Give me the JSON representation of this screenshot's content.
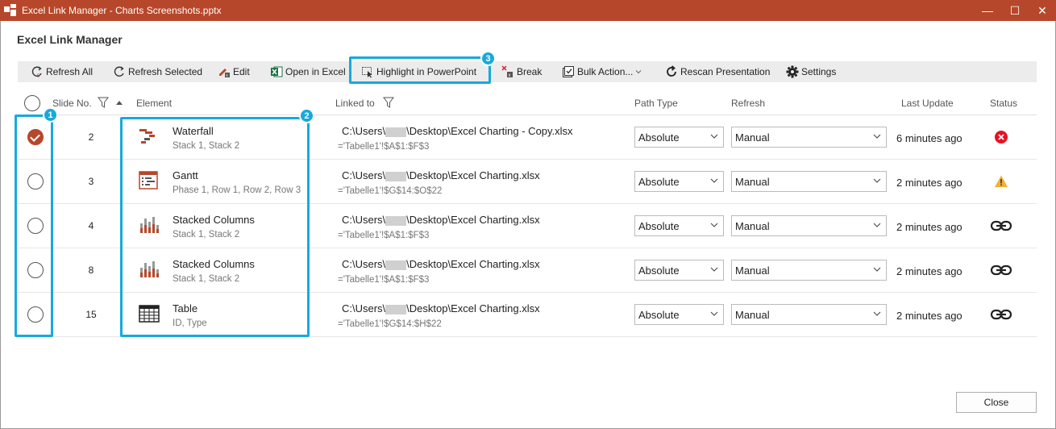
{
  "window": {
    "title": "Excel Link Manager - Charts Screenshots.pptx",
    "minimize": "—",
    "maximize": "☐",
    "close": "✕"
  },
  "heading": "Excel Link Manager",
  "toolbar": {
    "refresh_all": "Refresh All",
    "refresh_selected": "Refresh Selected",
    "edit": "Edit",
    "open_in_excel": "Open in Excel",
    "highlight": "Highlight in PowerPoint",
    "break": "Break",
    "bulk_actions": "Bulk Action...",
    "rescan": "Rescan Presentation",
    "settings": "Settings"
  },
  "badges": {
    "one": "1",
    "two": "2",
    "three": "3"
  },
  "columns": {
    "slide_no": "Slide No.",
    "element": "Element",
    "linked_to": "Linked to",
    "path_type": "Path Type",
    "refresh": "Refresh",
    "last_update": "Last Update",
    "status": "Status"
  },
  "rows": [
    {
      "checked": true,
      "slide": "2",
      "icon": "waterfall-icon",
      "name": "Waterfall",
      "sub": "Stack 1, Stack 2",
      "path_pre": "C:\\Users\\",
      "path_post": "\\Desktop\\Excel Charting - Copy.xlsx",
      "range": "='Tabelle1'!$A$1:$F$3",
      "path_type": "Absolute",
      "refresh": "Manual",
      "updated": "6 minutes ago",
      "status": "error"
    },
    {
      "checked": false,
      "slide": "3",
      "icon": "gantt-icon",
      "name": "Gantt",
      "sub": "Phase 1, Row 1, Row 2, Row 3",
      "path_pre": "C:\\Users\\",
      "path_post": "\\Desktop\\Excel Charting.xlsx",
      "range": "='Tabelle1'!$G$14:$O$22",
      "path_type": "Absolute",
      "refresh": "Manual",
      "updated": "2 minutes ago",
      "status": "warning"
    },
    {
      "checked": false,
      "slide": "4",
      "icon": "stacked-columns-icon",
      "name": "Stacked Columns",
      "sub": "Stack 1, Stack 2",
      "path_pre": "C:\\Users\\",
      "path_post": "\\Desktop\\Excel Charting.xlsx",
      "range": "='Tabelle1'!$A$1:$F$3",
      "path_type": "Absolute",
      "refresh": "Manual",
      "updated": "2 minutes ago",
      "status": "linked"
    },
    {
      "checked": false,
      "slide": "8",
      "icon": "stacked-columns-icon",
      "name": "Stacked Columns",
      "sub": "Stack 1, Stack 2",
      "path_pre": "C:\\Users\\",
      "path_post": "\\Desktop\\Excel Charting.xlsx",
      "range": "='Tabelle1'!$A$1:$F$3",
      "path_type": "Absolute",
      "refresh": "Manual",
      "updated": "2 minutes ago",
      "status": "linked"
    },
    {
      "checked": false,
      "slide": "15",
      "icon": "table-icon",
      "name": "Table",
      "sub": "ID, Type",
      "path_pre": "C:\\Users\\",
      "path_post": "\\Desktop\\Excel Charting.xlsx",
      "range": "='Tabelle1'!$G$14:$H$22",
      "path_type": "Absolute",
      "refresh": "Manual",
      "updated": "2 minutes ago",
      "status": "linked"
    }
  ],
  "close_button": "Close",
  "colors": {
    "titlebar": "#B7472A",
    "highlight": "#17A9DC",
    "error": "#E81123",
    "warning": "#F2B035"
  }
}
